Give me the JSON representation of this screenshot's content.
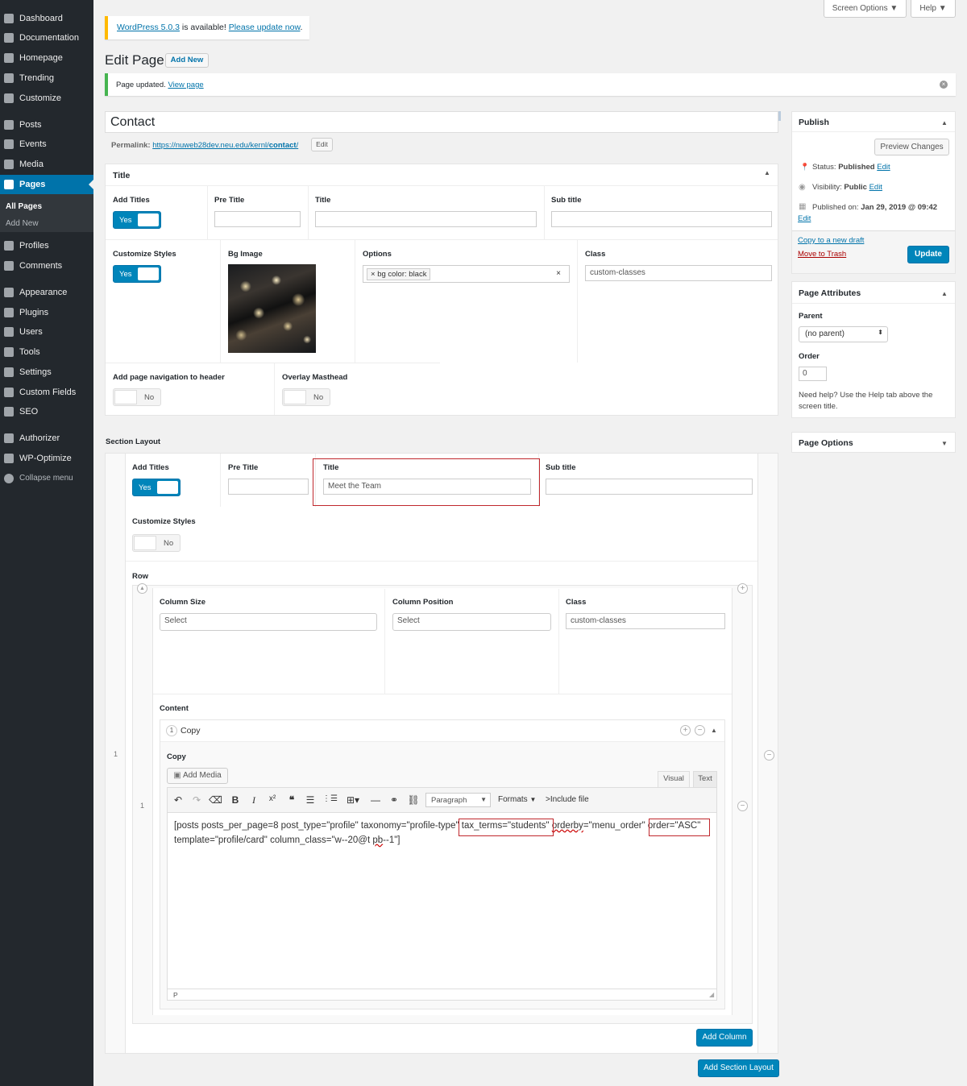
{
  "sidebar": {
    "items": [
      {
        "label": "Dashboard",
        "icon": "dashboard-icon"
      },
      {
        "label": "Documentation",
        "icon": "pencil-icon"
      },
      {
        "label": "Homepage",
        "icon": "home-icon"
      },
      {
        "label": "Trending",
        "icon": "chart-icon"
      },
      {
        "label": "Customize",
        "icon": "diamond-icon"
      },
      {
        "label": "Posts",
        "icon": "pin-icon"
      },
      {
        "label": "Events",
        "icon": "calendar-icon"
      },
      {
        "label": "Media",
        "icon": "media-icon"
      },
      {
        "label": "Pages",
        "icon": "pages-icon"
      },
      {
        "label": "Profiles",
        "icon": "pages-icon"
      },
      {
        "label": "Comments",
        "icon": "comment-icon"
      },
      {
        "label": "Appearance",
        "icon": "brush-icon"
      },
      {
        "label": "Plugins",
        "icon": "plug-icon"
      },
      {
        "label": "Users",
        "icon": "user-icon"
      },
      {
        "label": "Tools",
        "icon": "wrench-icon"
      },
      {
        "label": "Settings",
        "icon": "settings-icon"
      },
      {
        "label": "Custom Fields",
        "icon": "grid-icon"
      },
      {
        "label": "SEO",
        "icon": "seo-icon"
      },
      {
        "label": "Authorizer",
        "icon": "gear-icon"
      },
      {
        "label": "WP-Optimize",
        "icon": "optimize-icon"
      },
      {
        "label": "Collapse menu",
        "icon": "collapse-icon"
      }
    ],
    "pages_sub": {
      "all": "All Pages",
      "add": "Add New"
    }
  },
  "top": {
    "screen_options": "Screen Options ▼",
    "help": "Help ▼"
  },
  "notice": {
    "version": "WordPress 5.0.3",
    "mid": " is available! ",
    "update": "Please update now",
    "end": "."
  },
  "heading": {
    "title": "Edit Page",
    "add_new": "Add New"
  },
  "updated": {
    "text": "Page updated.",
    "link": "View page"
  },
  "post": {
    "title": "Contact",
    "permalink_label": "Permalink:",
    "permalink_base": "https://nuweb28dev.neu.edu/kernl/",
    "permalink_slug": "contact",
    "permalink_end": "/",
    "edit": "Edit"
  },
  "banner": {
    "title": "Title",
    "add_titles": "Add Titles",
    "pre_title": "Pre Title",
    "sub_title": "Sub title",
    "yes": "Yes",
    "customize_styles": "Customize Styles",
    "bg_image": "Bg Image",
    "options": "Options",
    "option_tag": "bg color: black",
    "class": "Class",
    "class_value": "custom-classes",
    "nav": "Add page navigation to header",
    "no": "No",
    "overlay": "Overlay Masthead"
  },
  "section": {
    "heading": "Section Layout",
    "add_titles": "Add Titles",
    "pre_title": "Pre Title",
    "title": "Title",
    "title_value": "Meet the Team",
    "sub_title": "Sub title",
    "yes": "Yes",
    "customize_styles": "Customize Styles",
    "no": "No",
    "row": "Row",
    "column_size": "Column Size",
    "column_position": "Column Position",
    "class": "Class",
    "select": "Select",
    "class_value": "custom-classes",
    "content": "Content",
    "row_index": "1",
    "copy_num": "1",
    "copy_title": "Copy",
    "copy_label": "Copy",
    "add_media": "Add Media",
    "visual": "Visual",
    "text": "Text",
    "paragraph": "Paragraph",
    "formats": "Formats",
    "include": ">Include file",
    "code_a": "[posts posts_per_page=8 post_type=\"profile\" taxonomy=\"profile-type\"",
    "code_b": "tax_terms=\"students\"",
    "code_c": "orderby",
    "code_d": "=\"menu_order\"",
    "code_e": "order=\"ASC\"",
    "code_f": "template=\"profile/card\" column_class=\"w--20@t ",
    "code_g": "pb",
    "code_h": "--1\"]",
    "path": "P",
    "add_column": "Add Column",
    "add_section": "Add Section Layout"
  },
  "publish": {
    "title": "Publish",
    "preview": "Preview Changes",
    "status_label": "Status: ",
    "status": "Published",
    "visibility_label": "Visibility: ",
    "visibility": "Public",
    "published_label": "Published on: ",
    "published": "Jan 29, 2019 @ 09:42",
    "edit": "Edit",
    "copy_draft": "Copy to a new draft",
    "trash": "Move to Trash",
    "update": "Update"
  },
  "attrs": {
    "title": "Page Attributes",
    "parent": "Parent",
    "parent_value": "(no parent)",
    "order": "Order",
    "order_value": "0",
    "help": "Need help? Use the Help tab above the",
    "help2": "screen title."
  },
  "page_options": {
    "title": "Page Options"
  }
}
